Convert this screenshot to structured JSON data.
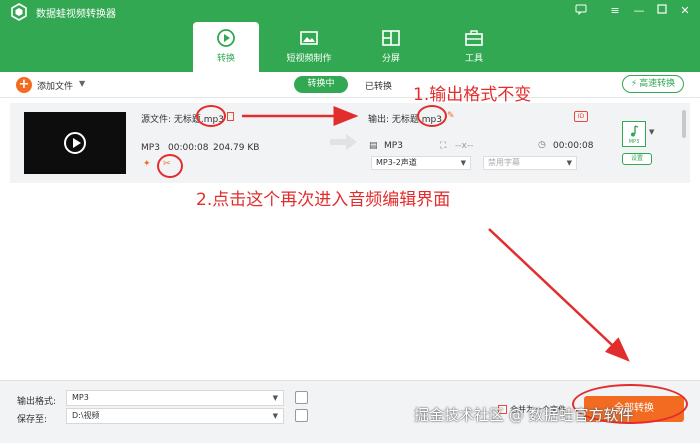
{
  "app": {
    "title": "数据蛙视频转换器",
    "controls": [
      "feedback-icon",
      "menu-icon",
      "minimize-icon",
      "maximize-icon",
      "close-icon"
    ]
  },
  "tabs": [
    {
      "label": "转换",
      "icon": "convert-icon",
      "active": true
    },
    {
      "label": "短视频制作",
      "icon": "video-maker-icon",
      "active": false
    },
    {
      "label": "分屏",
      "icon": "split-screen-icon",
      "active": false
    },
    {
      "label": "工具",
      "icon": "toolbox-icon",
      "active": false
    }
  ],
  "toolbar": {
    "add_file": "添加文件",
    "converting": "转换中",
    "converted": "已转换",
    "fast_convert": "高速转换"
  },
  "file": {
    "source_label": "源文件: 无标题.mp3",
    "format": "MP3",
    "duration": "00:00:08",
    "size": "204.79 KB",
    "output_label": "输出: 无标题.mp3",
    "out_format": "MP3",
    "resolution": "--x--",
    "out_duration": "00:00:08",
    "audio_channel": "MP3-2声道",
    "subtitle": "禁用字幕",
    "format_badge": "MP3",
    "settings": "设置"
  },
  "annotations": {
    "note1": "1.输出格式不变",
    "note2": "2.点击这个再次进入音频编辑界面"
  },
  "bottom": {
    "output_format_label": "输出格式:",
    "output_format_value": "MP3",
    "save_to_label": "保存至:",
    "save_to_value": "D:\\视频",
    "merge_label": "合并为一个文件",
    "convert_all": "全部转换"
  },
  "watermark": "掘金技术社区 @ 数据蛙官方软件",
  "colors": {
    "brand_green": "#32a852",
    "accent_orange": "#f26b21",
    "annotation_red": "#e32d2d"
  }
}
